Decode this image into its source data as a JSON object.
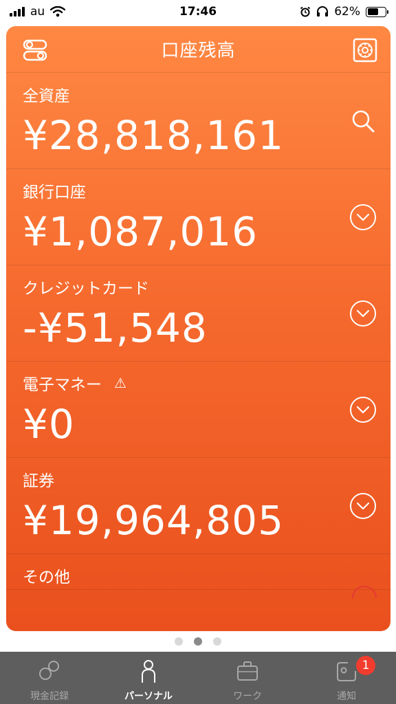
{
  "status_bar": {
    "carrier": "au",
    "time": "17:46",
    "battery": "62%"
  },
  "header": {
    "title": "口座残高"
  },
  "accounts": [
    {
      "label": "全資産",
      "value": "¥28,818,161",
      "icon": "search-icon"
    },
    {
      "label": "銀行口座",
      "value": "¥1,087,016",
      "icon": "chevron-down-circle-icon"
    },
    {
      "label": "クレジットカード",
      "value": "-¥51,548",
      "icon": "chevron-down-circle-icon"
    },
    {
      "label": "電子マネー",
      "value": "¥0",
      "warning": "⚠",
      "icon": "chevron-down-circle-icon"
    },
    {
      "label": "証券",
      "value": "¥19,964,805",
      "icon": "chevron-down-circle-icon"
    },
    {
      "label": "その他"
    }
  ],
  "tabs": [
    {
      "label": "現金記録",
      "icon": "cash-record-icon"
    },
    {
      "label": "パーソナル",
      "icon": "person-icon"
    },
    {
      "label": "ワーク",
      "icon": "briefcase-icon"
    },
    {
      "label": "通知",
      "icon": "notification-icon",
      "badge": "1"
    }
  ],
  "colors": {
    "card_top": "#ff8843",
    "card_bottom": "#e9501d",
    "tab_bar": "#5e5e5e",
    "badge": "#f23c2e"
  }
}
